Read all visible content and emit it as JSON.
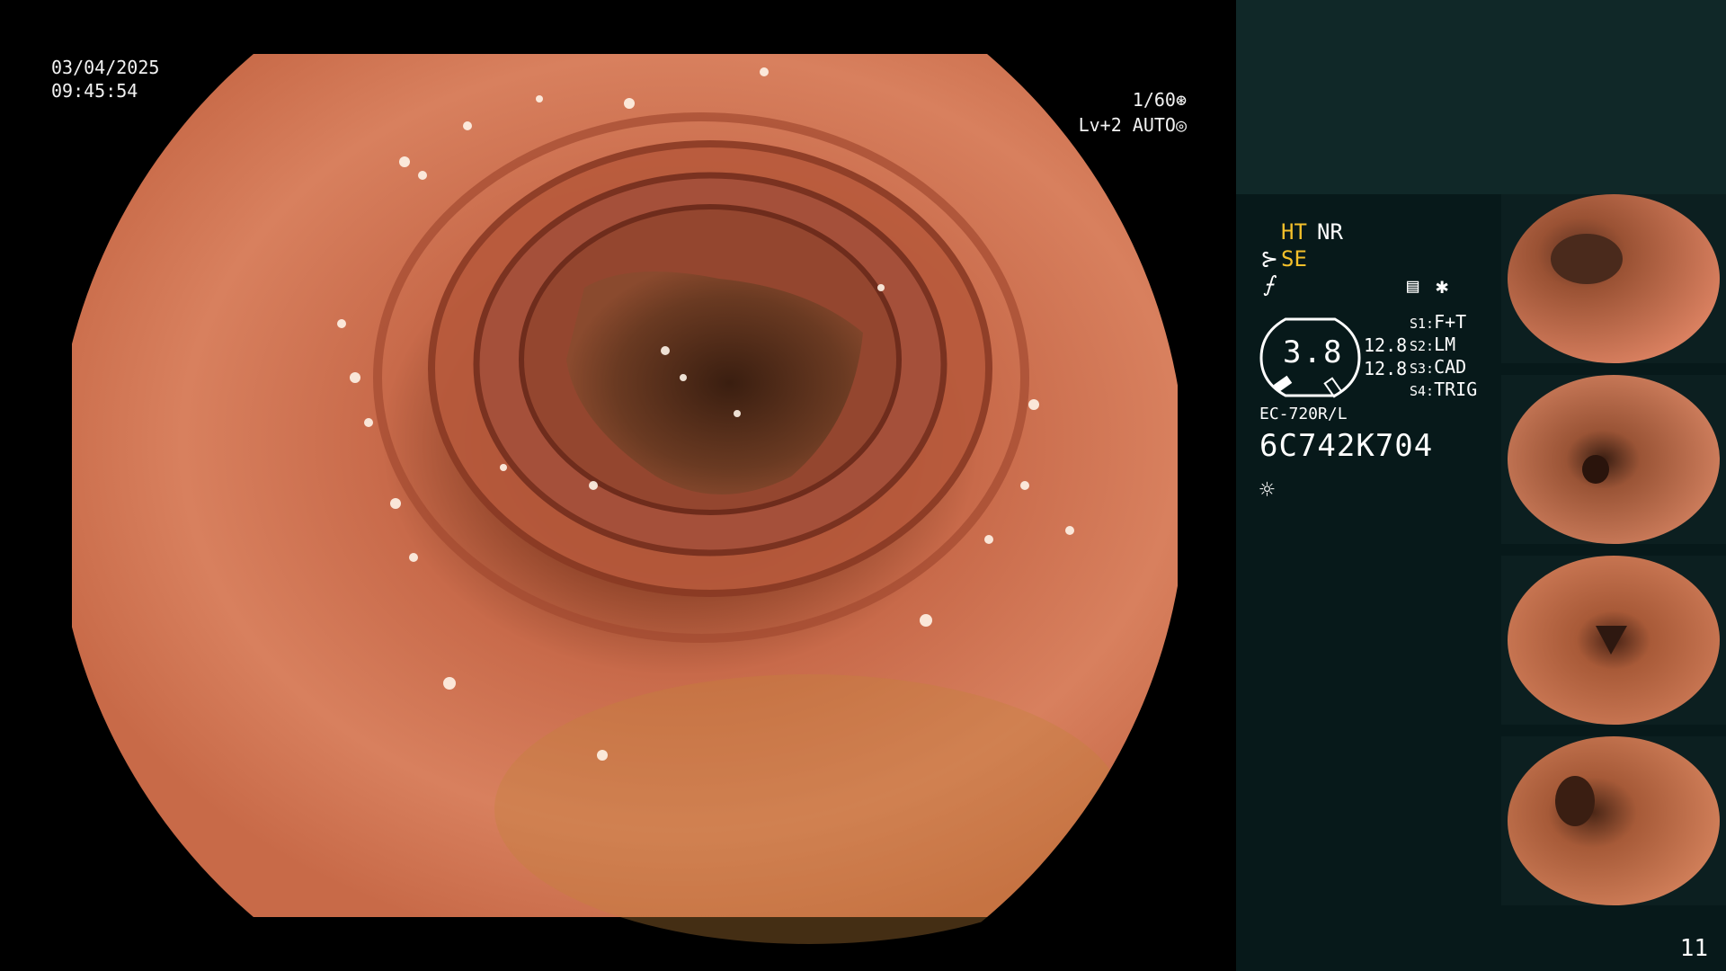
{
  "overlay": {
    "date": "03/04/2025",
    "time": "09:45:54",
    "shutter": "1/60",
    "shutter_icon": "aperture-icon",
    "level": "Lv+2 AUTO",
    "level_icon": "iris-icon"
  },
  "panel": {
    "modes": {
      "ht": "HT",
      "nr": "NR",
      "se": "SE"
    },
    "icons": {
      "se_icon": "⊱",
      "f_icon": "⨍",
      "menu_icon": "▤",
      "star_icon": "✱",
      "sun_icon": "☼"
    },
    "zoom": "3.8",
    "signals": [
      "12.8",
      "12.8"
    ],
    "switches": [
      {
        "key": "S1:",
        "value": "F+T"
      },
      {
        "key": "S2:",
        "value": "LM"
      },
      {
        "key": "S3:",
        "value": "CAD"
      },
      {
        "key": "S4:",
        "value": "TRIG"
      }
    ],
    "model": "EC-720R/L",
    "serial": "6C742K704",
    "page": "11"
  },
  "colors": {
    "panel_bg": "#07191a",
    "panel_top": "#102828",
    "mode_accent": "#f4c02a",
    "tissue": "#d67a5a"
  }
}
